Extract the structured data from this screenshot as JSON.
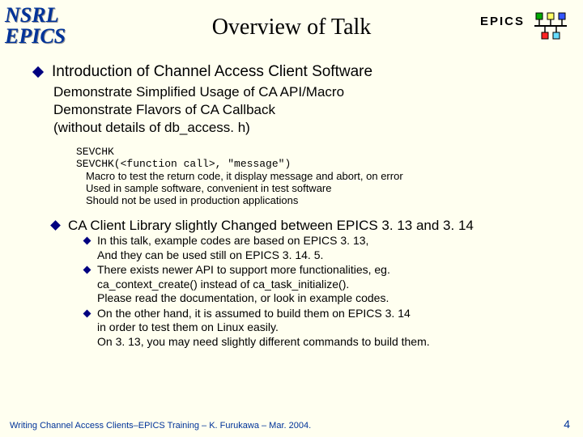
{
  "left_logo_line1": "NSRL",
  "left_logo_line2": "EPICS",
  "title": "Overview of Talk",
  "epics_label": "EPICS",
  "main_bullet": "Introduction of Channel Access Client Software",
  "sub1": "Demonstrate Simplified Usage of CA API/Macro",
  "sub2": "Demonstrate Flavors of CA Callback",
  "sub3": "(without details of db_access. h)",
  "code1": "SEVCHK",
  "code2": "SEVCHK(<function call>, \"message\")",
  "desc1": "Macro to test the return code, it display message and abort, on error",
  "desc2": "Used in sample software, convenient in test software",
  "desc3": "Should not be used in production applications",
  "bullet2": "CA Client Library slightly Changed between EPICS 3. 13 and 3. 14",
  "b2_1a": "In this talk, example codes are based on EPICS 3. 13,",
  "b2_1b": "And they can be used still on EPICS 3. 14. 5.",
  "b2_2a": "There exists newer API to support more functionalities, eg.",
  "b2_2b": "ca_context_create() instead of ca_task_initialize().",
  "b2_2c": "Please read the documentation, or look in example codes.",
  "b2_3a": "On the other hand, it is assumed to build them on EPICS 3. 14",
  "b2_3b": "in order to test them on Linux easily.",
  "b2_3c": "On 3. 13, you may need slightly different commands to build them.",
  "footer": "Writing Channel Access Clients–EPICS Training – K. Furukawa – Mar. 2004.",
  "pagenum": "4"
}
